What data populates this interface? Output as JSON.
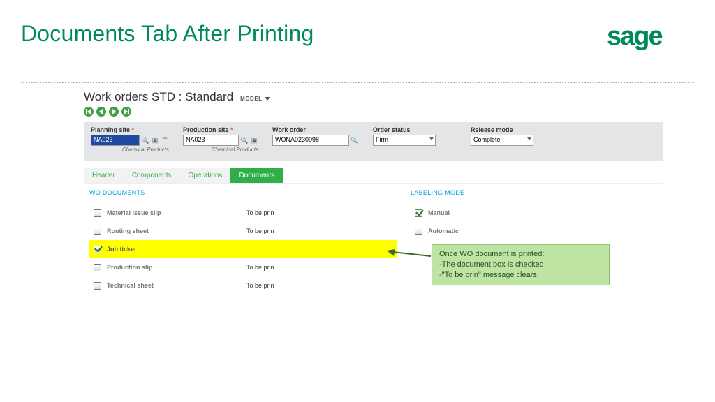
{
  "slide": {
    "title": "Documents Tab After Printing",
    "logo_text": "sage"
  },
  "app": {
    "title": "Work orders STD : Standard",
    "model_label": "MODEL"
  },
  "filters": {
    "planning_site": {
      "label": "Planning site",
      "value": "NA023",
      "sublabel": "Chemical Products"
    },
    "production_site": {
      "label": "Production site",
      "value": "NA023",
      "sublabel": "Chemical Products"
    },
    "work_order": {
      "label": "Work order",
      "value": "WONA0230098"
    },
    "order_status": {
      "label": "Order status",
      "value": "Firm"
    },
    "release_mode": {
      "label": "Release mode",
      "value": "Complete"
    }
  },
  "tabs": [
    "Header",
    "Components",
    "Operations",
    "Documents"
  ],
  "sections": {
    "wo_documents": "WO DOCUMENTS",
    "labeling_mode": "LABELING MODE"
  },
  "docs": [
    {
      "label": "Material issue slip",
      "status": "To be prin",
      "checked": false,
      "highlight": false
    },
    {
      "label": "Routing sheet",
      "status": "To be prin",
      "checked": false,
      "highlight": false
    },
    {
      "label": "Job ticket",
      "status": "",
      "checked": true,
      "highlight": true
    },
    {
      "label": "Production slip",
      "status": "To be prin",
      "checked": false,
      "highlight": false
    },
    {
      "label": "Technical sheet",
      "status": "To be prin",
      "checked": false,
      "highlight": false
    }
  ],
  "labeling": [
    {
      "label": "Manual",
      "checked": true
    },
    {
      "label": "Automatic",
      "checked": false
    }
  ],
  "callout": {
    "line1": "Once WO document is printed:",
    "line2": "-The document box is checked",
    "line3": "-\"To be prin\" message clears."
  }
}
